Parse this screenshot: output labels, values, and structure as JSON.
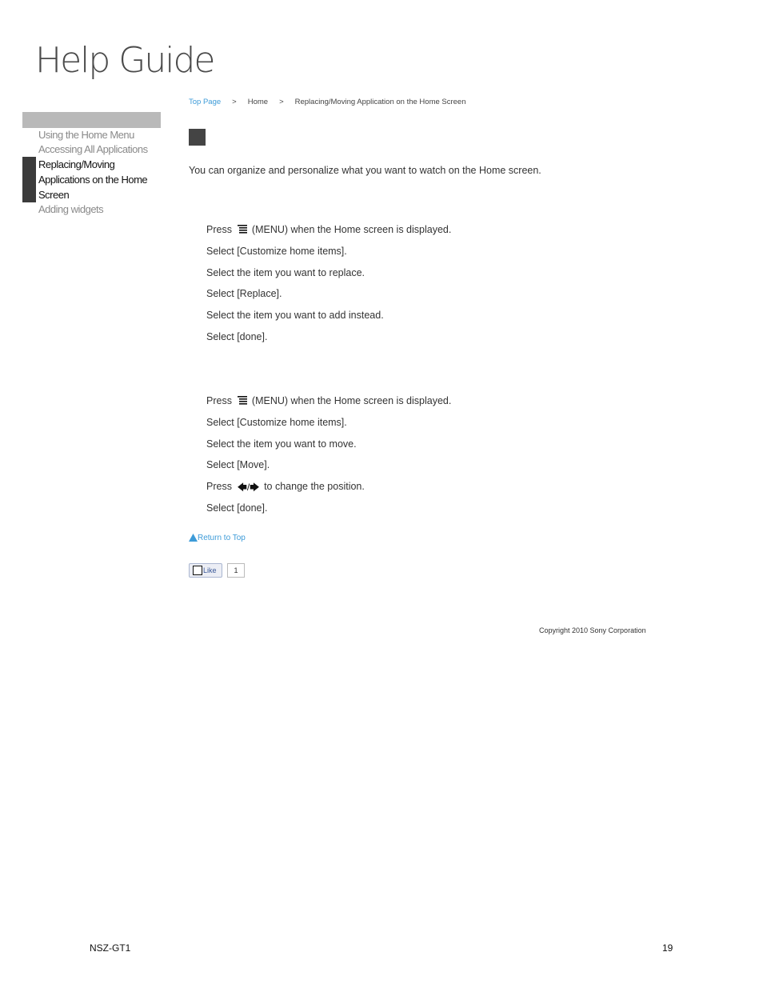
{
  "logo": "Help Guide",
  "breadcrumb": {
    "top_page": "Top Page",
    "sep1": ">",
    "home": "Home",
    "sep2": ">",
    "current": "Replacing/Moving Application on the Home Screen"
  },
  "sidebar": {
    "items": [
      {
        "label": "Using the Home Menu"
      },
      {
        "label": "Accessing All Applications"
      },
      {
        "label": "Replacing/Moving Applications on the Home Screen",
        "lines": [
          "Replacing/Moving",
          "Applications on the Home",
          "Screen"
        ]
      },
      {
        "label": "Adding widgets"
      }
    ]
  },
  "intro": "You can organize and personalize what you want to watch on the Home screen.",
  "replace_steps": {
    "s1_pre": "Press",
    "s1_post": "(MENU) when the Home screen is displayed.",
    "s2": "Select [Customize home items].",
    "s3": "Select the item you want to replace.",
    "s4": "Select [Replace].",
    "s5": "Select the item you want to add instead.",
    "s6": "Select [done]."
  },
  "move_steps": {
    "s1_pre": "Press",
    "s1_post": "(MENU) when the Home screen is displayed.",
    "s2": "Select [Customize home items].",
    "s3": "Select the item you want to move.",
    "s4": "Select [Move].",
    "s5_pre": "Press",
    "s5_arrows": "🡄/🡆",
    "s5_post": "to change the position.",
    "s6": "Select [done]."
  },
  "return_top": "Return to Top",
  "like": {
    "label": "Like",
    "count": "1"
  },
  "copyright": "Copyright 2010 Sony Corporation",
  "footer": {
    "model": "NSZ-GT1",
    "page": "19"
  },
  "icons": {
    "menu": "menu-icon",
    "return": "triangle-up-icon",
    "like": "checkbox-icon"
  },
  "colors": {
    "link": "#3d9bd8",
    "active_bar": "#3b3b3b",
    "sidebar_header": "#b9b9b9"
  }
}
